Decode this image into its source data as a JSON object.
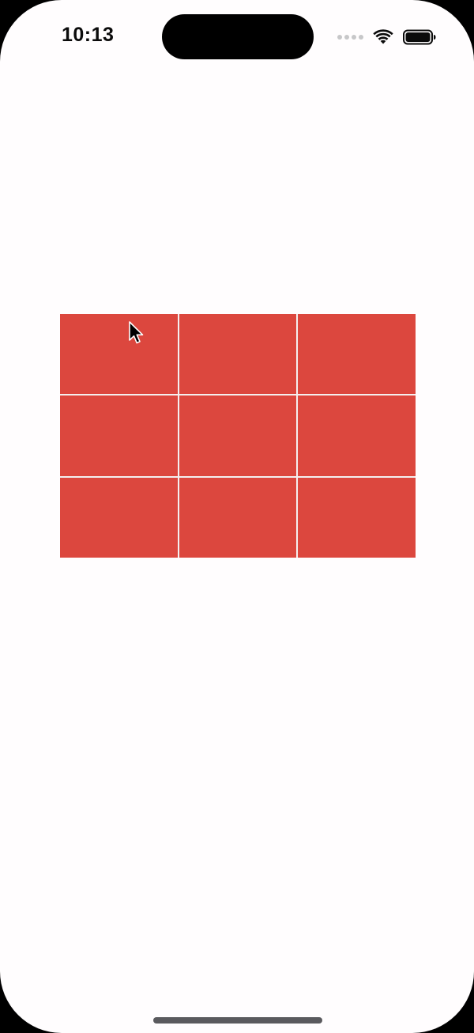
{
  "status_bar": {
    "time": "10:13",
    "icons": [
      "signal-dots-icon",
      "wifi-icon",
      "battery-icon"
    ]
  },
  "grid": {
    "rows": 3,
    "columns": 3,
    "cell_color": "#dc473e",
    "line_color": "#f4f0f0",
    "cells": [
      "",
      "",
      "",
      "",
      "",
      "",
      "",
      "",
      ""
    ]
  },
  "colors": {
    "background": "#fffdfe",
    "bezel": "#000000"
  }
}
